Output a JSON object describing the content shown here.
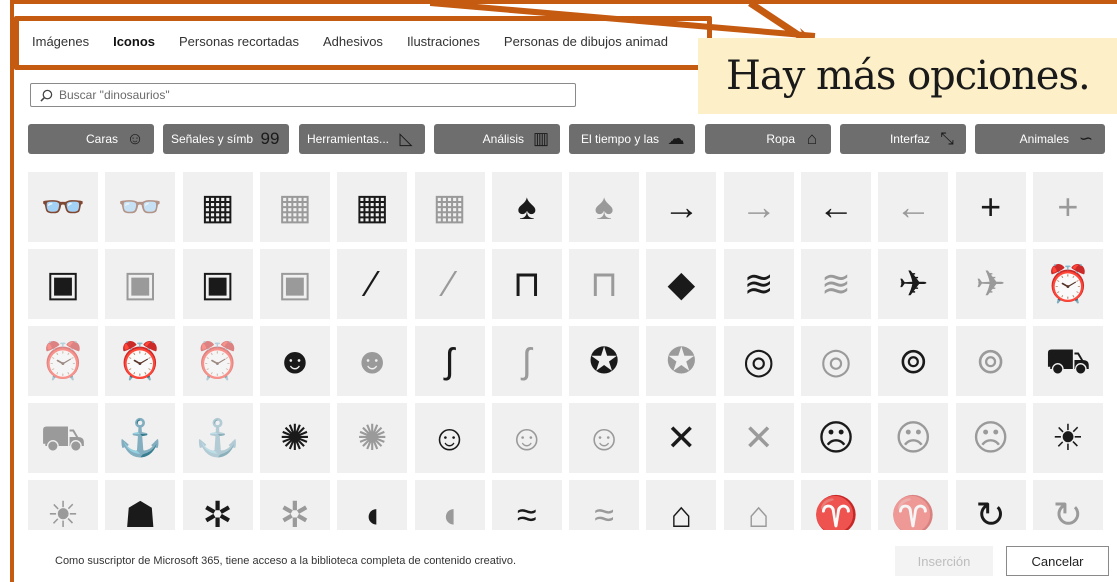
{
  "tabs": [
    {
      "label": "Imágenes",
      "active": false
    },
    {
      "label": "Iconos",
      "active": true
    },
    {
      "label": "Personas recortadas",
      "active": false
    },
    {
      "label": "Adhesivos",
      "active": false
    },
    {
      "label": "Ilustraciones",
      "active": false
    },
    {
      "label": "Personas de dibujos animad",
      "active": false
    }
  ],
  "callout": {
    "text": "Hay más opciones."
  },
  "search": {
    "placeholder": "Buscar \"dinosaurios\"",
    "icon": "search-icon"
  },
  "categories": [
    {
      "label": "Caras",
      "icon": "☺"
    },
    {
      "label": "Señales y símb",
      "icon": "99"
    },
    {
      "label": "Herramientas...",
      "icon": "◺"
    },
    {
      "label": "Análisis",
      "icon": "▥"
    },
    {
      "label": "El tiempo y las",
      "icon": "☁"
    },
    {
      "label": "Ropa",
      "icon": "⌂"
    },
    {
      "label": "Interfaz",
      "icon": "⤡"
    },
    {
      "label": "Animales",
      "icon": "∽"
    }
  ],
  "icons": [
    [
      "3d-glasses-filled",
      "3d-glasses-outline",
      "abacus-filled",
      "abacus-outline",
      "abacus-filled",
      "abacus-outline",
      "acorn-filled",
      "acorn-outline",
      "arrow-right-filled",
      "arrow-right-outline",
      "arrow-left-filled",
      "arrow-left-outline",
      "plus-filled",
      "plus-outline"
    ],
    [
      "address-book-filled",
      "address-book-outline",
      "address-book-filled",
      "address-book-outline",
      "bandage-filled",
      "bandage-outline",
      "billboard-filled",
      "billboard-outline",
      "africa-filled",
      "farm-field-filled",
      "farm-field-outline",
      "airplane-filled",
      "airplane-outline",
      "alarm-clock-filled"
    ],
    [
      "alarm-clock-outline",
      "alarm-ringing-filled",
      "alarm-ringing-outline",
      "alien-filled",
      "alien-outline",
      "needle-thread-filled",
      "needle-thread-outline",
      "yarn-filled",
      "yarn-outline",
      "tape-measure-filled",
      "tape-measure-outline",
      "button-filled",
      "button-outline",
      "ambulance-filled"
    ],
    [
      "ambulance-outline",
      "anchor-filled",
      "anchor-outline",
      "anemone-fish-filled",
      "anemone-fish-outline",
      "angel-face-filled",
      "angel-face-outline",
      "angel-face-outline",
      "anger-symbol-filled",
      "anger-symbol-outline",
      "angry-face-filled",
      "angry-face-outline",
      "angry-face-outline",
      "ant-filled"
    ],
    [
      "ant-outline",
      "antarctica-filled",
      "aperture-filled",
      "aperture-outline",
      "apple-filled",
      "apple-outline",
      "wave-filled",
      "wave-outline",
      "architect-filled",
      "architect-outline",
      "aries-filled",
      "aries-outline",
      "refresh-filled",
      "refresh-outline"
    ]
  ],
  "footer": {
    "note": "Como suscriptor de Microsoft 365, tiene acceso a la biblioteca completa de contenido creativo.",
    "insert_label": "Inserción",
    "cancel_label": "Cancelar"
  }
}
